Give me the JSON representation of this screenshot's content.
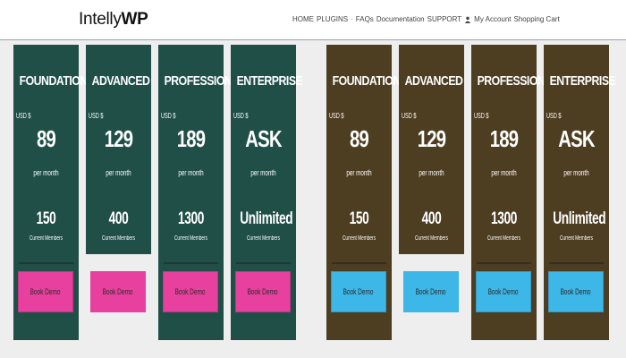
{
  "header": {
    "logo_regular": "Intelly",
    "logo_bold": "WP",
    "nav": {
      "home": "HOME",
      "plugins": "PLUGINS",
      "separator": "·",
      "faqs": "FAQs",
      "documentation": "Documentation",
      "support": "SUPPORT",
      "my_account": "My Account",
      "shopping_cart": "Shopping Cart"
    }
  },
  "currency_label": "USD $",
  "period_label": "per month",
  "members_label": "Current Members",
  "button_label": "Book Demo",
  "colors": {
    "green_panel": "#1f4f47",
    "brown_panel": "#4d3d21",
    "pink_button": "#e8409e",
    "blue_button": "#3db7e8"
  },
  "plans_green": [
    {
      "name": "FOUNDATION",
      "price": "89",
      "members": "150"
    },
    {
      "name": "ADVANCED",
      "price": "129",
      "members": "400"
    },
    {
      "name": "PROFESSIONAL",
      "price": "189",
      "members": "1300"
    },
    {
      "name": "ENTERPRISE",
      "price": "ASK",
      "members": "Unlimited"
    }
  ],
  "plans_brown": [
    {
      "name": "FOUNDATION",
      "price": "89",
      "members": "150"
    },
    {
      "name": "ADVANCED",
      "price": "129",
      "members": "400"
    },
    {
      "name": "PROFESSIONAL",
      "price": "189",
      "members": "1300"
    },
    {
      "name": "ENTERPRISE",
      "price": "ASK",
      "members": "Unlimited"
    }
  ]
}
